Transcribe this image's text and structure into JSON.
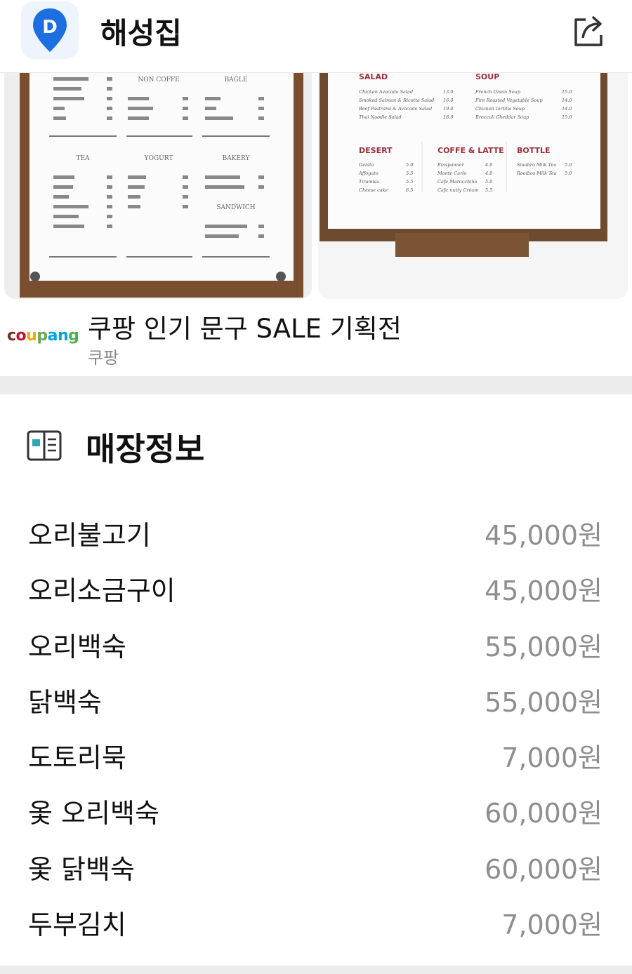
{
  "header": {
    "title": "해성집",
    "app_icon": "map-pin-d-icon",
    "share_icon": "share-icon"
  },
  "ad": {
    "left_board": {
      "headers": [
        "NON COFFE",
        "BAGLE",
        "TEA",
        "YOGURT",
        "BAKERY",
        "SANDWICH"
      ]
    },
    "right_board": {
      "headers": [
        "SALAD",
        "SOUP",
        "DESERT",
        "COFFE & LATTE",
        "BOTTLE"
      ],
      "salad": [
        [
          "Chicken Avocado Salad",
          "13.0"
        ],
        [
          "Smoked Salmon & Ricotta Salad",
          "16.0"
        ],
        [
          "Beef Pastrami & Avocado Salad",
          "19.0"
        ],
        [
          "Thai Noodle Salad",
          "18.0"
        ]
      ],
      "soup": [
        [
          "French Onion Soup",
          "15.0"
        ],
        [
          "Fire Roasted Vegetable Soup",
          "14.0"
        ],
        [
          "Chicken tortilla Soup",
          "14.0"
        ],
        [
          "Broccoli Cheddar Soup",
          "15.0"
        ]
      ],
      "desert": [
        [
          "Gelato",
          "5.0"
        ],
        [
          "Affogato",
          "5.5"
        ],
        [
          "Tiramisu",
          "5.5"
        ],
        [
          "Cheese cake",
          "6.5"
        ]
      ],
      "coffee": [
        [
          "Einspanner",
          "4.0"
        ],
        [
          "Monte Carlo",
          "4.0"
        ],
        [
          "Cafe Marocchino",
          "5.0"
        ],
        [
          "Cafe nutty Cream",
          "5.5"
        ]
      ],
      "bottle": [
        [
          "Sinabro Milk Tea",
          "5.0"
        ],
        [
          "Rooibos Milk Tea",
          "5.0"
        ]
      ]
    },
    "brand_logo": "coupang",
    "title": "쿠팡 인기 문구 SALE 기획전",
    "subtitle": "쿠팡"
  },
  "section": {
    "icon": "menu-book-icon",
    "title": "매장정보"
  },
  "menu": [
    {
      "name": "오리불고기",
      "price": "45,000원"
    },
    {
      "name": "오리소금구이",
      "price": "45,000원"
    },
    {
      "name": "오리백숙",
      "price": "55,000원"
    },
    {
      "name": "닭백숙",
      "price": "55,000원"
    },
    {
      "name": "도토리묵",
      "price": "7,000원"
    },
    {
      "name": "옻 오리백숙",
      "price": "60,000원"
    },
    {
      "name": "옻 닭백숙",
      "price": "60,000원"
    },
    {
      "name": "두부김치",
      "price": "7,000원"
    }
  ],
  "colors": {
    "accent": "#1a73e8",
    "price": "#8e8e8e",
    "band": "#ececef",
    "board_title_red": "#9b2f3a"
  }
}
